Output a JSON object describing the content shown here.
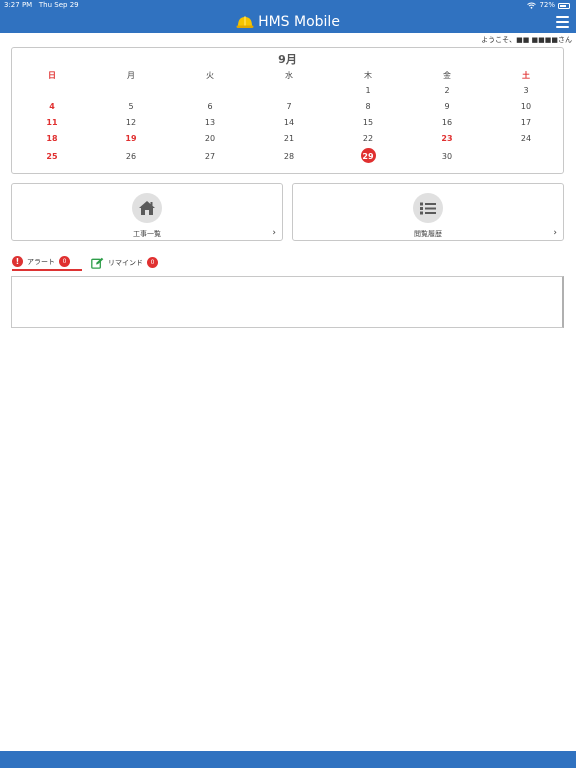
{
  "status": {
    "time": "3:27 PM",
    "date": "Thu Sep 29",
    "battery": "72%"
  },
  "header": {
    "title": "HMS Mobile"
  },
  "user": {
    "welcome": "ようこそ、■■ ■■■■さん"
  },
  "calendar": {
    "month": "9月",
    "weekdays": [
      "日",
      "月",
      "火",
      "水",
      "木",
      "金",
      "土"
    ],
    "today": "29",
    "red_days": [
      "4",
      "11",
      "18",
      "19",
      "23",
      "25"
    ],
    "weeks": [
      [
        "",
        "",
        "",
        "",
        "1",
        "2",
        "3"
      ],
      [
        "4",
        "5",
        "6",
        "7",
        "8",
        "9",
        "10"
      ],
      [
        "11",
        "12",
        "13",
        "14",
        "15",
        "16",
        "17"
      ],
      [
        "18",
        "19",
        "20",
        "21",
        "22",
        "23",
        "24"
      ],
      [
        "25",
        "26",
        "27",
        "28",
        "29",
        "30",
        ""
      ]
    ]
  },
  "nav": {
    "construction_list": "工事一覧",
    "browse_history": "閲覧履歴",
    "chevron": "›"
  },
  "tabs": {
    "alert": {
      "label": "アラート",
      "count": "0",
      "icon": "!"
    },
    "remind": {
      "label": "リマインド",
      "count": "0"
    }
  },
  "colors": {
    "header": "#3072c0",
    "alert": "#e03030",
    "remind_icon": "#2e9e4a"
  }
}
